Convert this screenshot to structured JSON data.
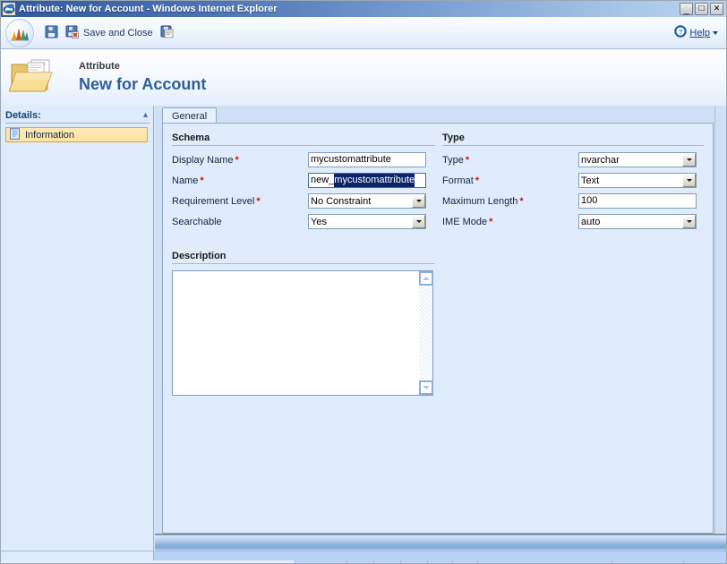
{
  "window": {
    "title": "Attribute: New for Account - Windows Internet Explorer",
    "app_icon": "internet-explorer-icon",
    "minimize_label": "_",
    "maximize_label": "□",
    "close_label": "✕"
  },
  "toolbar": {
    "logo_icon": "crm-orb-icon",
    "save_icon": "save-floppy-icon",
    "save_close_icon": "save-and-close-icon",
    "save_close_label": "Save and Close",
    "save_new_icon": "save-and-new-icon",
    "help_icon": "help-question-icon",
    "help_label": "Help",
    "help_caret_icon": "chevron-down-icon"
  },
  "header": {
    "folder_icon": "open-folder-icon",
    "kicker": "Attribute",
    "title": "New for Account"
  },
  "sidebar": {
    "details_label": "Details:",
    "collapse_icon": "chevron-up-icon",
    "items": [
      {
        "label": "Information",
        "icon": "information-page-icon",
        "selected": true
      }
    ]
  },
  "tabs": [
    {
      "label": "General",
      "active": true
    }
  ],
  "form": {
    "schema": {
      "title": "Schema",
      "fields": [
        {
          "label": "Display Name",
          "required": true,
          "control": "text",
          "value": "mycustomattribute",
          "focused": false
        },
        {
          "label": "Name",
          "required": true,
          "control": "text-with-selection",
          "value_prefix": "new_",
          "value_selected": "mycustomattribute",
          "focused": true
        },
        {
          "label": "Requirement Level",
          "required": true,
          "control": "dropdown",
          "value": "No Constraint"
        },
        {
          "label": "Searchable",
          "required": false,
          "control": "dropdown",
          "value": "Yes"
        }
      ]
    },
    "type": {
      "title": "Type",
      "fields": [
        {
          "label": "Type",
          "required": true,
          "control": "dropdown",
          "value": "nvarchar"
        },
        {
          "label": "Format",
          "required": true,
          "control": "dropdown",
          "value": "Text"
        },
        {
          "label": "Maximum Length",
          "required": true,
          "control": "text",
          "value": "100",
          "focused": false
        },
        {
          "label": "IME Mode",
          "required": true,
          "control": "dropdown",
          "value": "auto"
        }
      ]
    },
    "description": {
      "title": "Description",
      "value": "",
      "scroll_up_icon": "scroll-up-arrow-icon",
      "scroll_down_icon": "scroll-down-arrow-icon"
    }
  },
  "colors": {
    "title_bar_dark": "#2f5a9e",
    "title_bar_light": "#bcd4ef",
    "header_title": "#2e5f98",
    "required_asterisk": "#d01414",
    "selection_highlight": "#0a246a",
    "sidebar_bg": "#ddebfa",
    "selected_nav_bg": "#fde2a3",
    "selected_nav_border": "#e2a33a",
    "form_bg": "#e0ecfb",
    "pane_bg": "#cfe0f6",
    "status_bar": "#b9d2f8"
  }
}
